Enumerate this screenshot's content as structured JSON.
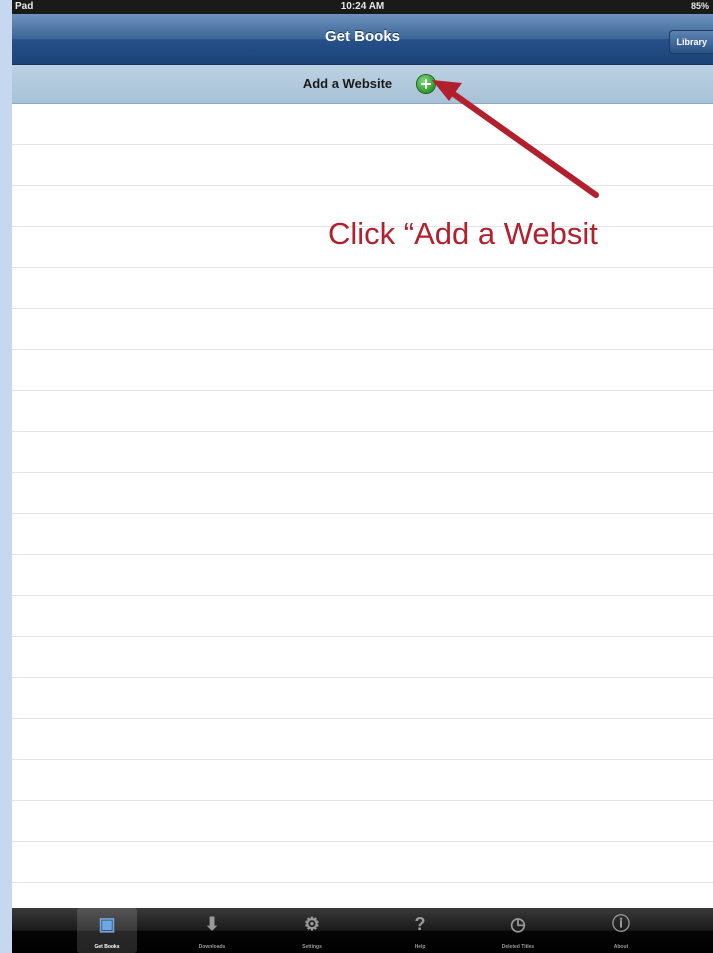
{
  "status_bar": {
    "carrier": "Pad",
    "time": "10:24 AM",
    "battery": "85%"
  },
  "nav": {
    "title": "Get Books",
    "library_button": "Library"
  },
  "add_bar": {
    "label": "Add a Website"
  },
  "annotation": {
    "text": "Click “Add a Websit",
    "color": "#b21f2d"
  },
  "tabs": [
    {
      "label": "Get Books",
      "icon": "get-books-icon",
      "active": true
    },
    {
      "label": "Downloads",
      "icon": "download-icon"
    },
    {
      "label": "Settings",
      "icon": "gears-icon"
    },
    {
      "label": "Help",
      "icon": "question-icon"
    },
    {
      "label": "Deleted Titles",
      "icon": "clock-icon"
    },
    {
      "label": "About",
      "icon": "info-icon"
    }
  ]
}
